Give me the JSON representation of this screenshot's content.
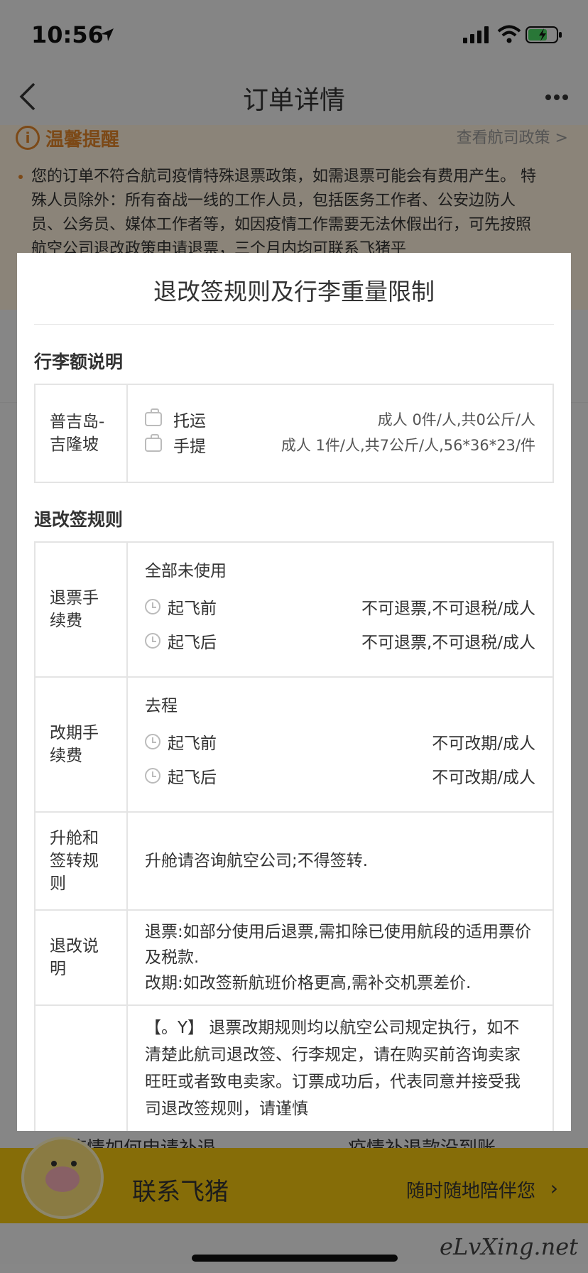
{
  "status_bar": {
    "time": "10:56"
  },
  "nav": {
    "title": "订单详情"
  },
  "notice": {
    "title": "温馨提醒",
    "link": "查看航司政策 >",
    "text": "您的订单不符合航司疫情特殊退票政策，如需退票可能会有费用产生。 特殊人员除外：所有奋战一线的工作人员，包括医务工作者、公安边防人员、公务员、媒体工作者等，如因疫情工作需要无法休假出行，可先按照航空公司退改政策申请退票，三个月内均可联系飞猪平"
  },
  "modal": {
    "title": "退改签规则及行李重量限制",
    "baggage_section_title": "行李额说明",
    "baggage": {
      "route": "普吉岛-吉隆坡",
      "items": [
        {
          "icon": "luggage-icon",
          "name": "托运",
          "value": "成人 0件/人,共0公斤/人"
        },
        {
          "icon": "luggage-icon",
          "name": "手提",
          "value": "成人 1件/人,共7公斤/人,56*36*23/件"
        }
      ]
    },
    "rules_section_title": "退改签规则",
    "refund": {
      "label": "退票手续费",
      "subhead": "全部未使用",
      "items": [
        {
          "name": "起飞前",
          "value": "不可退票,不可退税/成人"
        },
        {
          "name": "起飞后",
          "value": "不可退票,不可退税/成人"
        }
      ]
    },
    "change": {
      "label": "改期手续费",
      "subhead": "去程",
      "items": [
        {
          "name": "起飞前",
          "value": "不可改期/成人"
        },
        {
          "name": "起飞后",
          "value": "不可改期/成人"
        }
      ]
    },
    "upgrade": {
      "label": "升舱和签转规则",
      "text": "升舱请咨询航空公司;不得签转."
    },
    "explain": {
      "label": "退改说明",
      "line1": "退票:如部分使用后退票,需扣除已使用航段的适用票价及税款.",
      "line2": "改期:如改签新航班价格更高,需补交机票差价."
    },
    "disclaimer": "【。Y】 退票改期规则均以航空公司规定执行，如不清楚此航司退改签、行李规定，请在购买前咨询卖家旺旺或者致电卖家。订票成功后，代表同意并接受我司退改签规则，请谨慎"
  },
  "bottom": {
    "hidden_link_1": "疫情如何申请补退",
    "hidden_link_2": "疫情补退款没到账",
    "contact_label": "联系飞猪",
    "contact_sub": "随时随地陪伴您"
  },
  "watermark": "eLvXing.net",
  "colors": {
    "accent": "#e2862a",
    "brand_yellow": "#f5c70f"
  }
}
